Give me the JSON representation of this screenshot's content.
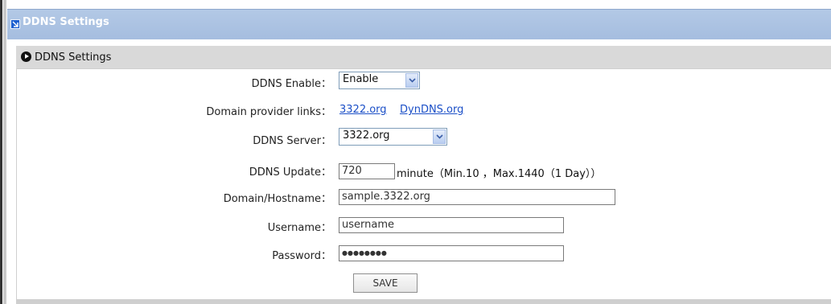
{
  "header": {
    "title": "DDNS Settings"
  },
  "section": {
    "title": "DDNS Settings"
  },
  "form": {
    "ddns_enable": {
      "label": "DDNS Enable：",
      "value": "Enable"
    },
    "provider_links": {
      "label": "Domain provider links：",
      "link1": "3322.org",
      "link2": "DynDNS.org"
    },
    "ddns_server": {
      "label": "DDNS Server：",
      "value": "3322.org"
    },
    "ddns_update": {
      "label": "DDNS Update：",
      "value": "720",
      "note": "minute（Min.10 ，Max.1440（1 Day））"
    },
    "hostname": {
      "label": "Domain/Hostname：",
      "value": "sample.3322.org"
    },
    "username": {
      "label": "Username：",
      "value": "username"
    },
    "password": {
      "label": "Password：",
      "value": "●●●●●●●●"
    }
  },
  "save_label": "SAVE",
  "colors": {
    "title_bar": "#a5bddf",
    "section_bar": "#d9d9d9",
    "link": "#1b4fc7"
  }
}
